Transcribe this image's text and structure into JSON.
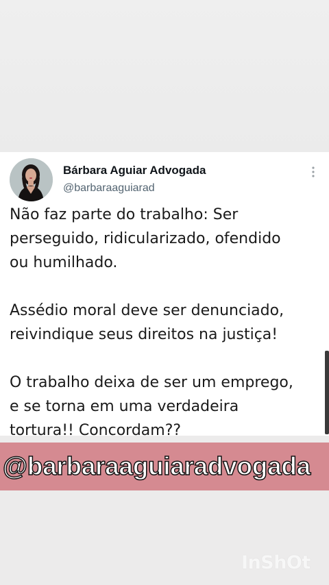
{
  "tweet": {
    "author_name": "Bárbara Aguiar Advogada",
    "author_handle": "@barbaraaguiarad",
    "paragraphs": [
      "Não faz parte do trabalho: Ser\nperseguido, ridicularizado, ofendido\nou humilhado.",
      "Assédio moral deve ser denunciado,\nreivindique seus direitos na justiça!",
      "O trabalho deixa de ser um emprego,\ne se torna em uma verdadeira\ntortura!! Concordam??"
    ],
    "more_icon": "vertical-dots-icon"
  },
  "banner": {
    "text": "@barbaraaguiaradvogada",
    "color": "#d58a91"
  },
  "watermark": {
    "text": "InShOt"
  }
}
